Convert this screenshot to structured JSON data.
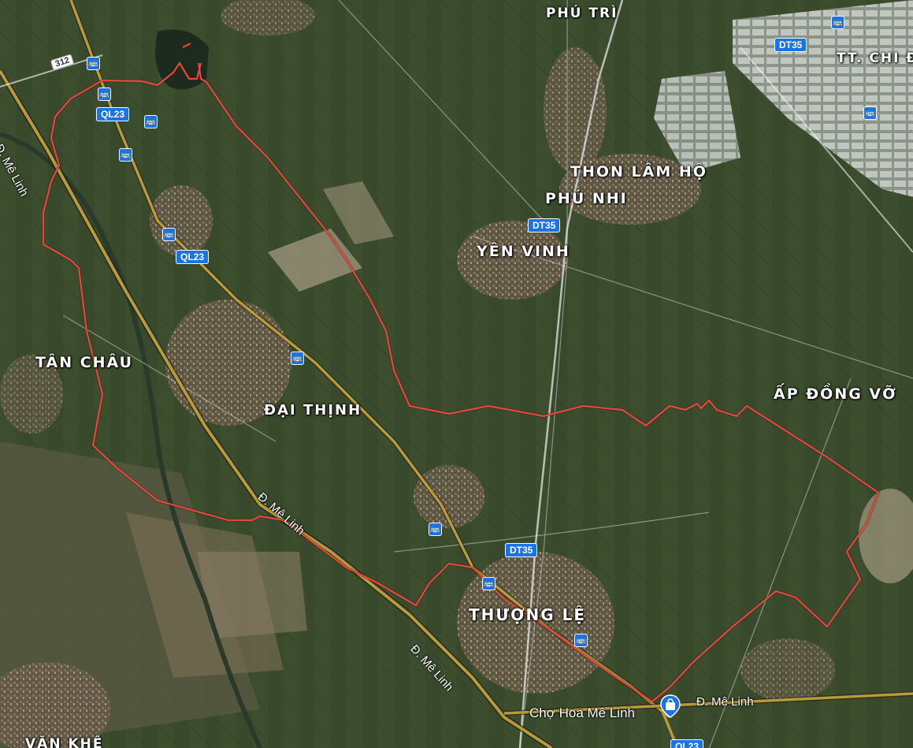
{
  "map": {
    "places": {
      "phu_tri": "PHÚ TRÌ",
      "tt_chi_dong": "TT. CHI Đ",
      "thon_lam_ho": "THON LÂM HỘ",
      "phu_nhi": "PHÚ NHI",
      "yen_vinh": "YÊN VINH",
      "tan_chau": "TÂN CHÂU",
      "dai_thinh": "ĐẠI THỊNH",
      "ap_dong_vo": "ẤP ĐỒNG VỠ",
      "thuong_le": "THƯỢNG LỆ",
      "van_khe": "VĂN KHÊ"
    },
    "road_shields": {
      "dt35_top": "DT35",
      "dt35_mid": "DT35",
      "dt35_bottom": "DT35",
      "ql23_a": "QL23",
      "ql23_b": "QL23",
      "ql23_bottom": "QL23",
      "r312": "312"
    },
    "streets": {
      "me_linh_left": "Đ. Mê Linh",
      "me_linh_center": "Đ. Mê Linh",
      "me_linh_lower": "Đ. Mê Linh",
      "me_linh_right": "Đ. Mê Linh"
    },
    "poi": {
      "label": "Chợ Hoa Mê Linh",
      "icon": "shopping-bag-icon"
    },
    "colors": {
      "boundary": "#e8473c",
      "highway": "#b89a3c",
      "transit": "#1a73e8"
    }
  }
}
